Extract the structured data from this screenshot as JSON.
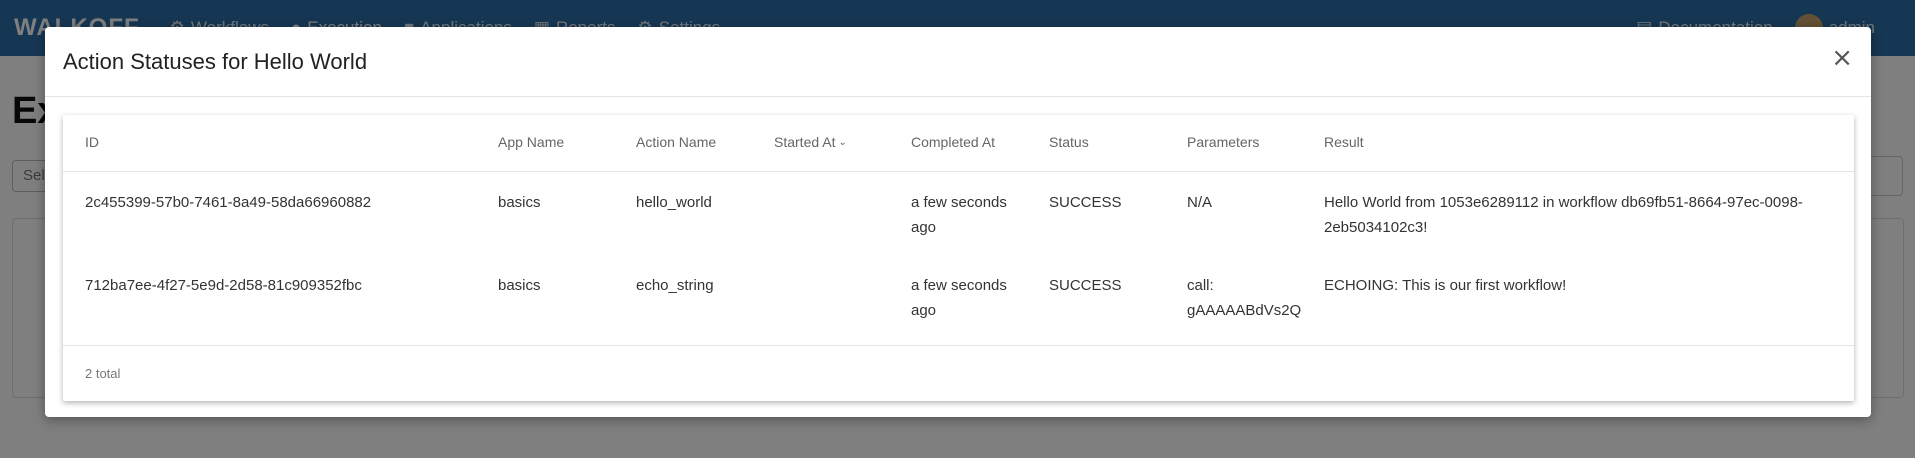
{
  "navbar": {
    "brand": "WALKOFF",
    "links": [
      "Workflows",
      "Execution",
      "Applications",
      "Reports",
      "Settings"
    ],
    "documentation": "Documentation",
    "user": "admin"
  },
  "page": {
    "title": "Ex",
    "select_placeholder": "Sel"
  },
  "modal": {
    "title": "Action Statuses for Hello World",
    "close_label": "×",
    "columns": [
      "ID",
      "App Name",
      "Action Name",
      "Started At",
      "Completed At",
      "Status",
      "Parameters",
      "Result"
    ],
    "rows": [
      {
        "id": "2c455399-57b0-7461-8a49-58da66960882",
        "app_name": "basics",
        "action_name": "hello_world",
        "started_at": "",
        "completed_at": "a few seconds ago",
        "status": "SUCCESS",
        "parameters": "N/A",
        "result": "Hello World from 1053e6289112 in workflow db69fb51-8664-97ec-0098-2eb5034102c3!"
      },
      {
        "id": "712ba7ee-4f27-5e9d-2d58-81c909352fbc",
        "app_name": "basics",
        "action_name": "echo_string",
        "started_at": "",
        "completed_at": "a few seconds ago",
        "status": "SUCCESS",
        "parameters": "call: gAAAAABdVs2Q",
        "result": "ECHOING: This is our first workflow!"
      }
    ],
    "footer": "2 total"
  }
}
